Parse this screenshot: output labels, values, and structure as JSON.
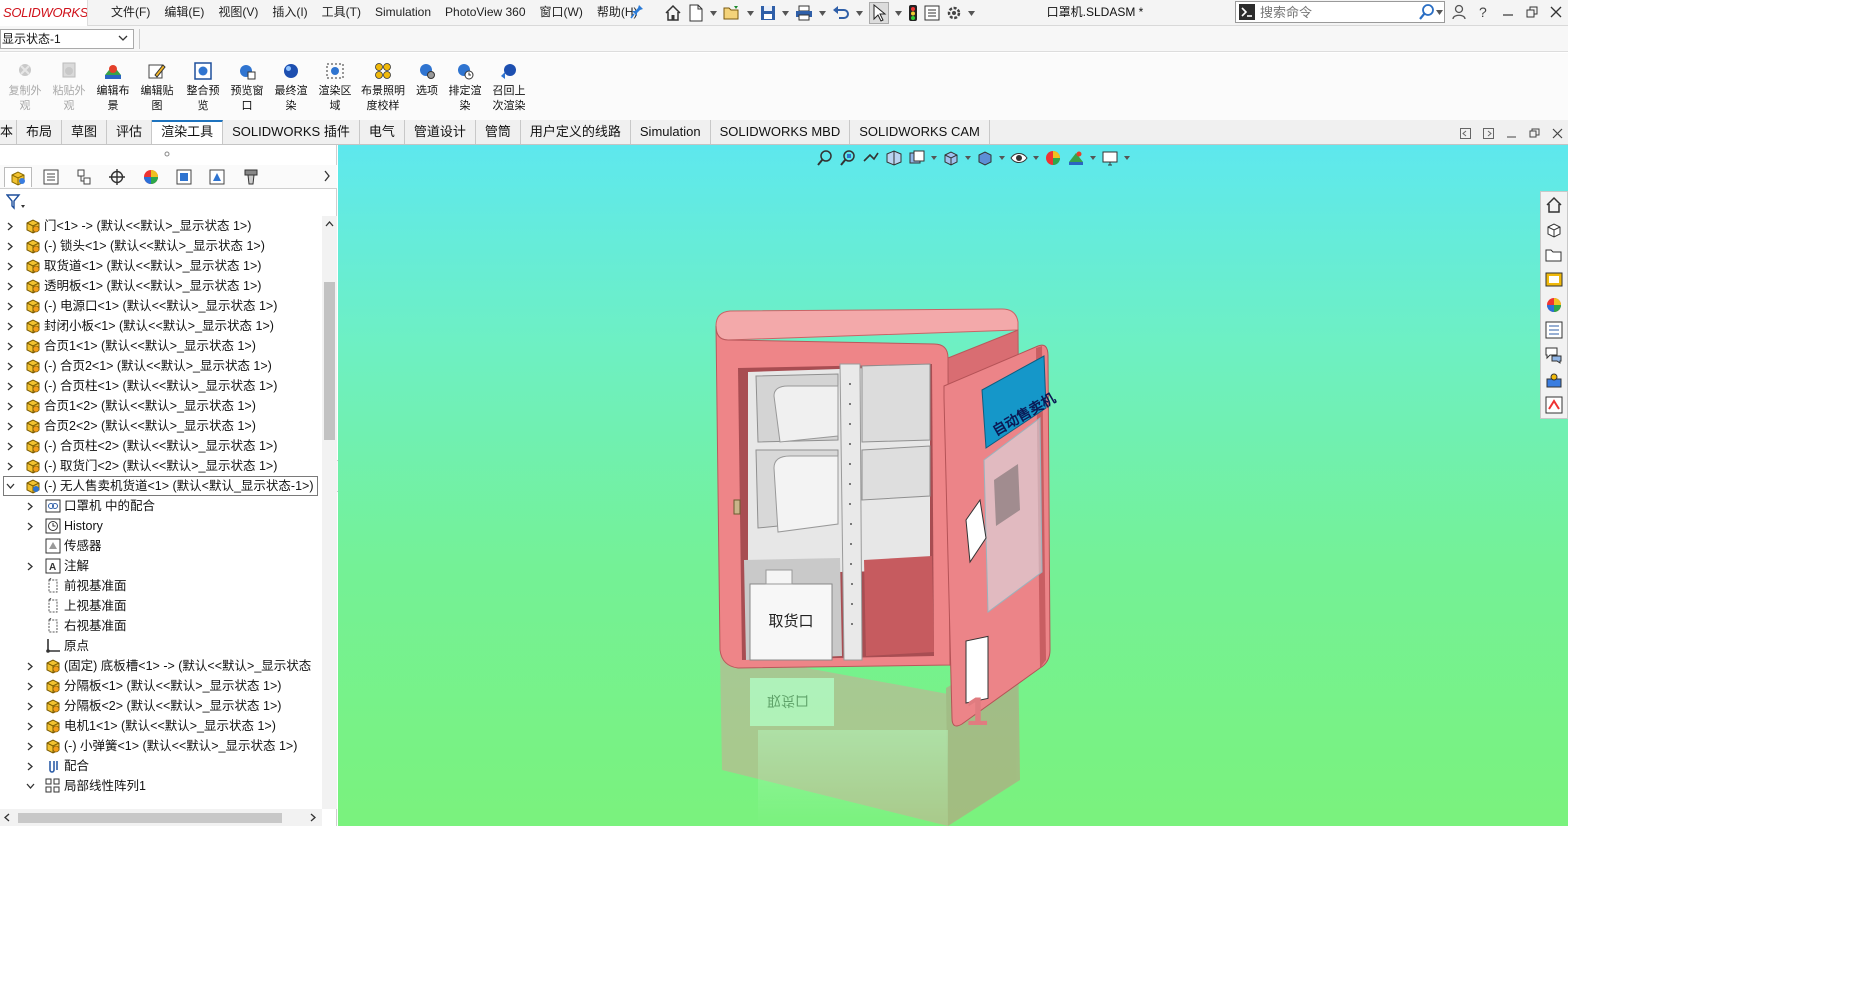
{
  "app": {
    "logo": "SOLIDWORKS",
    "doc_title": "口罩机.SLDASM *"
  },
  "menu": [
    "文件(F)",
    "编辑(E)",
    "视图(V)",
    "插入(I)",
    "工具(T)",
    "Simulation",
    "PhotoView 360",
    "窗口(W)",
    "帮助(H)"
  ],
  "search": {
    "placeholder": "搜索命令"
  },
  "display_state": {
    "selected": "显示状态-1"
  },
  "ribbon": [
    {
      "label": "复制外观",
      "enabled": false,
      "icon": "copy-appearance-icon"
    },
    {
      "label": "粘贴外观",
      "enabled": false,
      "icon": "paste-appearance-icon"
    },
    {
      "label": "编辑布景",
      "enabled": true,
      "icon": "edit-scene-icon"
    },
    {
      "label": "编辑贴图",
      "enabled": true,
      "icon": "edit-decal-icon"
    },
    {
      "label": "整合预览",
      "enabled": true,
      "icon": "integrated-preview-icon"
    },
    {
      "label": "预览窗口",
      "enabled": true,
      "icon": "preview-window-icon"
    },
    {
      "label": "最终渲染",
      "enabled": true,
      "icon": "final-render-icon"
    },
    {
      "label": "渲染区域",
      "enabled": true,
      "icon": "render-region-icon"
    },
    {
      "label": "布景照明度校样",
      "enabled": true,
      "icon": "scene-illumination-icon"
    },
    {
      "label": "选项",
      "enabled": true,
      "icon": "options-icon"
    },
    {
      "label": "排定渲染",
      "enabled": true,
      "icon": "schedule-render-icon"
    },
    {
      "label": "召回上次渲染",
      "enabled": true,
      "icon": "recall-render-icon"
    }
  ],
  "tabs": [
    {
      "label": "本",
      "active": false
    },
    {
      "label": "布局",
      "active": false
    },
    {
      "label": "草图",
      "active": false
    },
    {
      "label": "评估",
      "active": false
    },
    {
      "label": "渲染工具",
      "active": true
    },
    {
      "label": "SOLIDWORKS 插件",
      "active": false
    },
    {
      "label": "电气",
      "active": false
    },
    {
      "label": "管道设计",
      "active": false
    },
    {
      "label": "管筒",
      "active": false
    },
    {
      "label": "用户定义的线路",
      "active": false
    },
    {
      "label": "Simulation",
      "active": false
    },
    {
      "label": "SOLIDWORKS MBD",
      "active": false
    },
    {
      "label": "SOLIDWORKS CAM",
      "active": false
    }
  ],
  "tree": [
    {
      "label": "门<1> -> (默认<<默认>_显示状态 1>)",
      "icon": "part-icon",
      "level": 0,
      "expander": "collapsed"
    },
    {
      "label": "(-) 锁头<1> (默认<<默认>_显示状态 1>)",
      "icon": "part-icon",
      "level": 0,
      "expander": "collapsed"
    },
    {
      "label": "取货道<1> (默认<<默认>_显示状态 1>)",
      "icon": "part-icon",
      "level": 0,
      "expander": "collapsed"
    },
    {
      "label": "透明板<1> (默认<<默认>_显示状态 1>)",
      "icon": "part-icon",
      "level": 0,
      "expander": "collapsed"
    },
    {
      "label": "(-) 电源口<1> (默认<<默认>_显示状态 1>)",
      "icon": "part-icon",
      "level": 0,
      "expander": "collapsed"
    },
    {
      "label": "封闭小板<1> (默认<<默认>_显示状态 1>)",
      "icon": "part-icon",
      "level": 0,
      "expander": "collapsed"
    },
    {
      "label": "合页1<1> (默认<<默认>_显示状态 1>)",
      "icon": "part-icon",
      "level": 0,
      "expander": "collapsed"
    },
    {
      "label": "(-) 合页2<1> (默认<<默认>_显示状态 1>)",
      "icon": "part-icon",
      "level": 0,
      "expander": "collapsed"
    },
    {
      "label": "(-) 合页柱<1> (默认<<默认>_显示状态 1>)",
      "icon": "part-icon",
      "level": 0,
      "expander": "collapsed"
    },
    {
      "label": "合页1<2> (默认<<默认>_显示状态 1>)",
      "icon": "part-icon",
      "level": 0,
      "expander": "collapsed"
    },
    {
      "label": "合页2<2> (默认<<默认>_显示状态 1>)",
      "icon": "part-icon",
      "level": 0,
      "expander": "collapsed"
    },
    {
      "label": "(-) 合页柱<2> (默认<<默认>_显示状态 1>)",
      "icon": "part-icon",
      "level": 0,
      "expander": "collapsed"
    },
    {
      "label": "(-) 取货门<2> (默认<<默认>_显示状态 1>)",
      "icon": "part-icon",
      "level": 0,
      "expander": "collapsed"
    },
    {
      "label": "(-) 无人售卖机货道<1> (默认<默认_显示状态-1>)",
      "icon": "subassembly-icon",
      "level": 0,
      "expander": "expanded",
      "highlight": true
    },
    {
      "label": "口罩机 中的配合",
      "icon": "mates-folder-icon",
      "level": 1,
      "expander": "collapsed"
    },
    {
      "label": "History",
      "icon": "history-icon",
      "level": 1,
      "expander": "collapsed"
    },
    {
      "label": "传感器",
      "icon": "sensor-icon",
      "level": 1,
      "expander": "none"
    },
    {
      "label": "注解",
      "icon": "annotation-icon",
      "level": 1,
      "expander": "collapsed"
    },
    {
      "label": "前视基准面",
      "icon": "plane-icon",
      "level": 1,
      "expander": "none"
    },
    {
      "label": "上视基准面",
      "icon": "plane-icon",
      "level": 1,
      "expander": "none"
    },
    {
      "label": "右视基准面",
      "icon": "plane-icon",
      "level": 1,
      "expander": "none"
    },
    {
      "label": "原点",
      "icon": "origin-icon",
      "level": 1,
      "expander": "none"
    },
    {
      "label": "(固定) 底板槽<1> -> (默认<<默认>_显示状态",
      "icon": "part-icon",
      "level": 1,
      "expander": "collapsed"
    },
    {
      "label": "分隔板<1> (默认<<默认>_显示状态 1>)",
      "icon": "part-icon",
      "level": 1,
      "expander": "collapsed"
    },
    {
      "label": "分隔板<2> (默认<<默认>_显示状态 1>)",
      "icon": "part-icon",
      "level": 1,
      "expander": "collapsed"
    },
    {
      "label": "电机1<1> (默认<<默认>_显示状态 1>)",
      "icon": "part-icon",
      "level": 1,
      "expander": "collapsed"
    },
    {
      "label": "(-) 小弹簧<1> (默认<<默认>_显示状态 1>)",
      "icon": "part-icon",
      "level": 1,
      "expander": "collapsed"
    },
    {
      "label": "配合",
      "icon": "mate-icon",
      "level": 1,
      "expander": "collapsed"
    },
    {
      "label": "局部线性阵列1",
      "icon": "pattern-icon",
      "level": 1,
      "expander": "expanded"
    }
  ],
  "model": {
    "front_label": "取货口",
    "sign_text": "自动售卖机",
    "door_number": "1",
    "reflection_text": "取货口"
  },
  "colors": {
    "accent_blue": "#1e73be",
    "cabinet_red": "#e26d70",
    "viewport_top": "#5ee8ee",
    "viewport_bottom": "#7af27d",
    "sign_blue": "#1597c9"
  }
}
